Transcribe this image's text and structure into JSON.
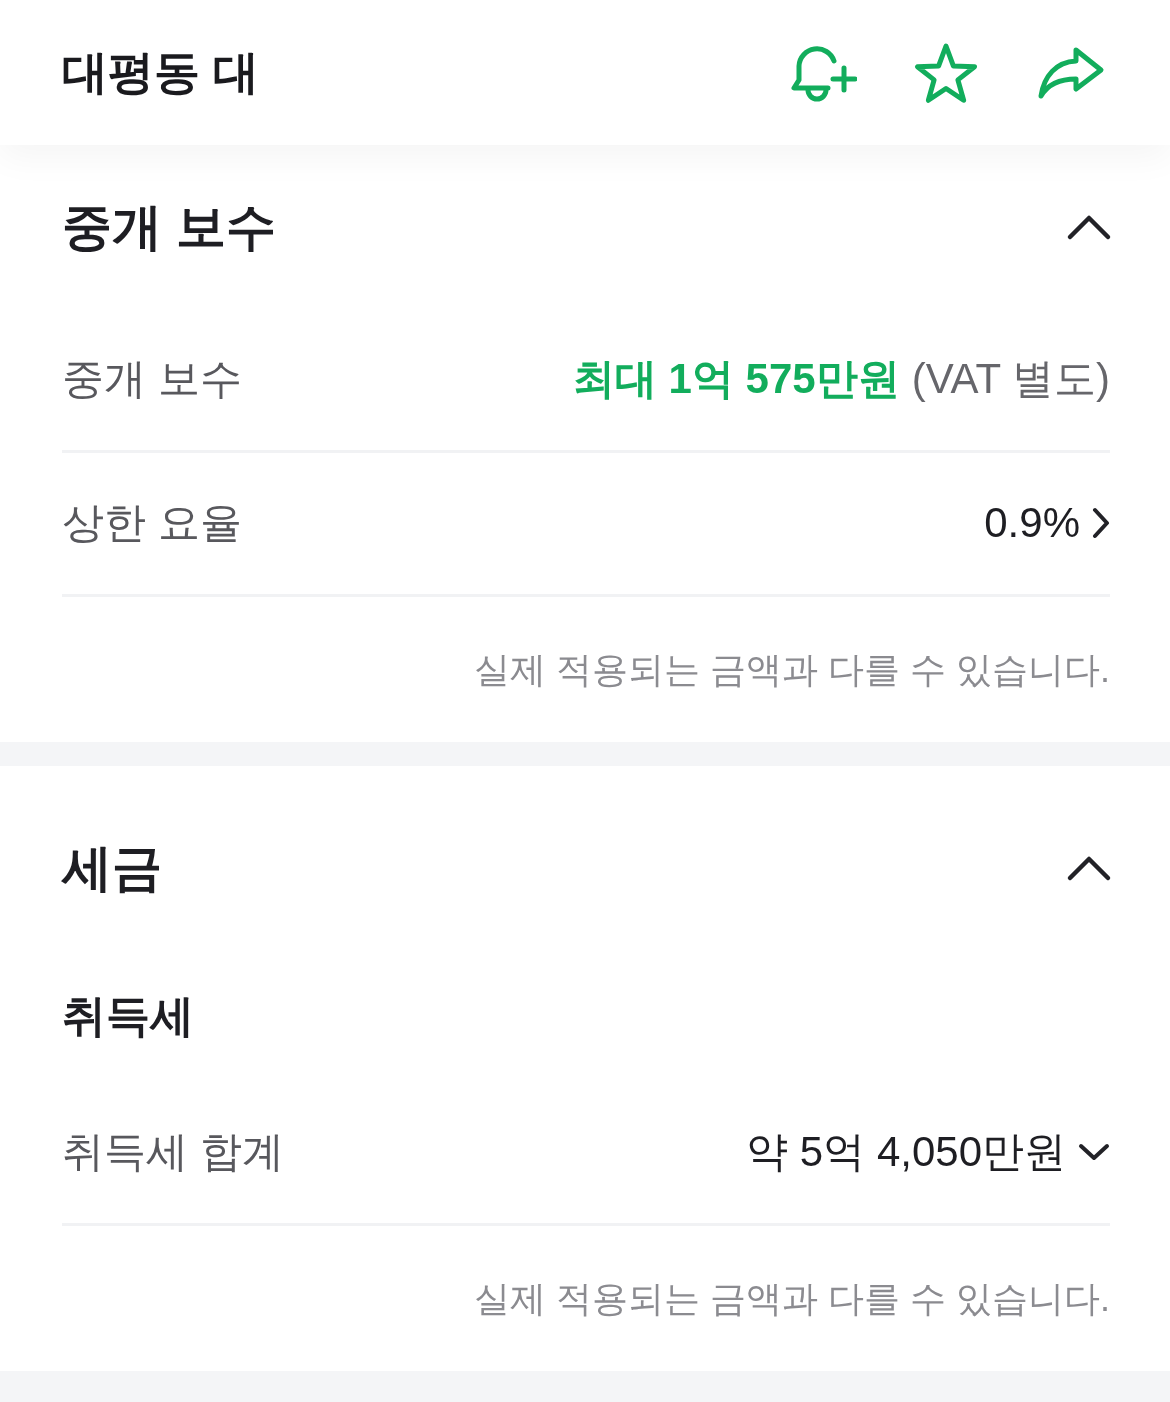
{
  "header": {
    "title": "대평동 대"
  },
  "sections": [
    {
      "title": "중개 보수",
      "expanded": true,
      "items": [
        {
          "kind": "row",
          "label": "중개 보수",
          "value": "최대 1억 575만원",
          "suffix": "(VAT 별도)",
          "emphasized": true,
          "navigable": false
        },
        {
          "kind": "row",
          "label": "상한 요율",
          "value": "0.9%",
          "emphasized": false,
          "navigable": true
        },
        {
          "kind": "note",
          "text": "실제 적용되는 금액과 다를 수 있습니다."
        }
      ]
    },
    {
      "title": "세금",
      "expanded": true,
      "items": [
        {
          "kind": "subheading",
          "text": "취득세"
        },
        {
          "kind": "row",
          "label": "취득세 합계",
          "value": "약 5억 4,050만원",
          "emphasized": false,
          "navigable": false,
          "expanded": false
        },
        {
          "kind": "note",
          "text": "실제 적용되는 금액과 다를 수 있습니다."
        }
      ]
    }
  ]
}
